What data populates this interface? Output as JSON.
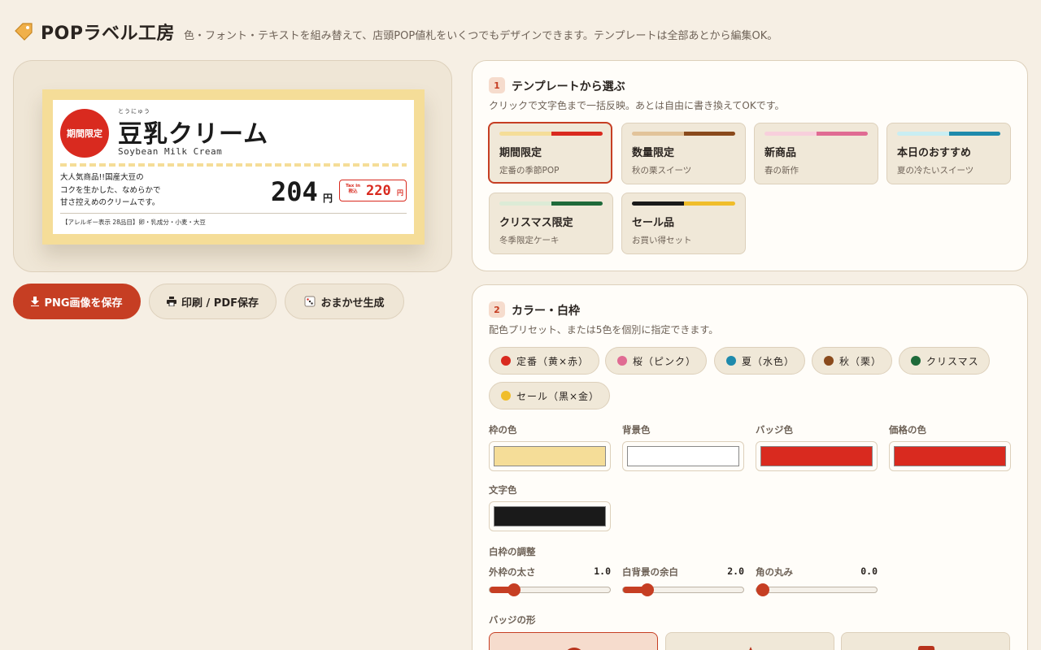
{
  "app": {
    "title": "POPラベル工房",
    "subtitle": "色・フォント・テキストを組み替えて、店頭POP値札をいくつでもデザインできます。テンプレートは全部あとから編集OK。",
    "icon": "tag-icon"
  },
  "pop": {
    "badge": "期間限定",
    "ruby": "とうにゅう",
    "name": "豆乳クリーム",
    "name_en": "Soybean Milk Cream",
    "desc_lines": [
      "大人気商品!!国産大豆の",
      "コクを生かした、なめらかで",
      "甘さ控えめのクリームです。"
    ],
    "price": "204",
    "yen": "円",
    "tax_label_line1": "Tax in",
    "tax_label_line2": "税込",
    "tax_price": "220",
    "tax_yen": "円",
    "allergy": "【アレルギー表示 28品目】卵・乳成分・小麦・大豆",
    "colors": {
      "frame": "#f5dd98",
      "background": "#ffffff",
      "badge": "#d92a1f",
      "price": "#d92a1f",
      "text": "#1a1a1a"
    }
  },
  "actions": {
    "save_png": "PNG画像を保存",
    "print": "印刷 / PDF保存",
    "random": "おまかせ生成"
  },
  "step1": {
    "num": "1",
    "title": "テンプレートから選ぶ",
    "desc": "クリックで文字色まで一括反映。あとは自由に書き換えてOKです。",
    "templates": [
      {
        "name": "期間限定",
        "sub": "定番の季節POP",
        "c1": "#f5dd98",
        "c2": "#d92a1f",
        "selected": true
      },
      {
        "name": "数量限定",
        "sub": "秋の栗スイーツ",
        "c1": "#e2c39a",
        "c2": "#8a4a1c",
        "selected": false
      },
      {
        "name": "新商品",
        "sub": "春の新作",
        "c1": "#f8cfdc",
        "c2": "#e06b93",
        "selected": false
      },
      {
        "name": "本日のおすすめ",
        "sub": "夏の冷たいスイーツ",
        "c1": "#c9eef2",
        "c2": "#1f8aac",
        "selected": false
      },
      {
        "name": "クリスマス限定",
        "sub": "冬季限定ケーキ",
        "c1": "#dcebd6",
        "c2": "#1f6a3a",
        "selected": false
      },
      {
        "name": "セール品",
        "sub": "お買い得セット",
        "c1": "#1a1a1a",
        "c2": "#f0bd2a",
        "selected": false
      }
    ]
  },
  "step2": {
    "num": "2",
    "title": "カラー・白枠",
    "desc": "配色プリセット、または5色を個別に指定できます。",
    "presets": [
      {
        "label": "定番（黄×赤）",
        "color": "#d92a1f"
      },
      {
        "label": "桜（ピンク）",
        "color": "#e06b93"
      },
      {
        "label": "夏（水色）",
        "color": "#1f8aac"
      },
      {
        "label": "秋（栗）",
        "color": "#8a4a1c"
      },
      {
        "label": "クリスマス",
        "color": "#1f6a3a"
      },
      {
        "label": "セール（黒×金）",
        "color": "#f0bd2a"
      }
    ],
    "color_fields": [
      {
        "label": "枠の色",
        "value": "#f5dd98"
      },
      {
        "label": "背景色",
        "value": "#ffffff"
      },
      {
        "label": "バッジ色",
        "value": "#d92a1f"
      },
      {
        "label": "価格の色",
        "value": "#d92a1f"
      },
      {
        "label": "文字色",
        "value": "#1a1a1a"
      }
    ],
    "frame_section": "白枠の調整",
    "sliders": [
      {
        "label": "外枠の太さ",
        "value": "1.0",
        "fraction": 0.2
      },
      {
        "label": "白背景の余白",
        "value": "2.0",
        "fraction": 0.2
      },
      {
        "label": "角の丸み",
        "value": "0.0",
        "fraction": 0.0
      }
    ],
    "badge_shape_label": "バッジの形",
    "badge_shapes": [
      {
        "icon": "circle-shape-icon",
        "selected": true
      },
      {
        "icon": "star-shape-icon",
        "selected": false
      },
      {
        "icon": "ribbon-shape-icon",
        "selected": false
      }
    ]
  }
}
